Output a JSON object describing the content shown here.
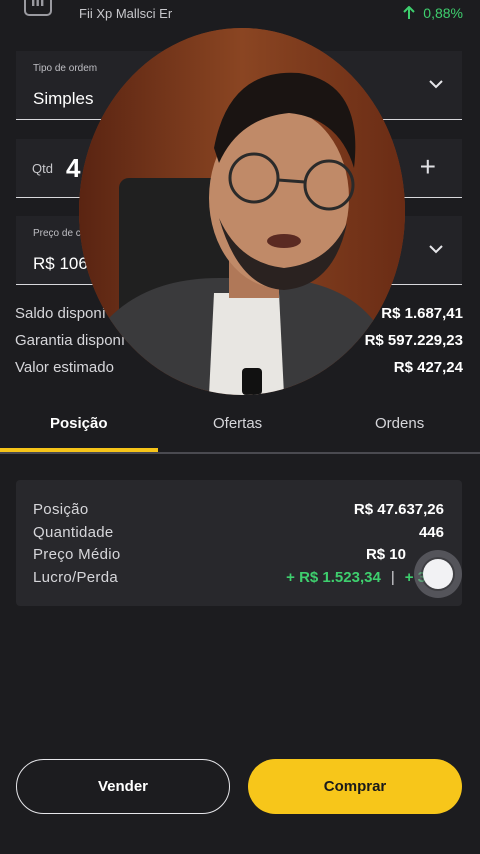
{
  "header": {
    "asset_name": "Fii Xp Mallsci Er",
    "change": "0,88%",
    "icons": {
      "asset": "chart-bars-icon",
      "trend": "arrow-up-icon"
    }
  },
  "order_form": {
    "order_type": {
      "label": "Tipo de ordem",
      "value": "Simples"
    },
    "quantity": {
      "label": "Qtd",
      "value": "4"
    },
    "price": {
      "label": "Preço de c",
      "value": "R$ 106"
    }
  },
  "summary": [
    {
      "label": "Saldo disponí",
      "value": "R$ 1.687,41"
    },
    {
      "label": "Garantia disponí",
      "value": "R$ 597.229,23"
    },
    {
      "label": "Valor estimado",
      "value": "R$ 427,24"
    }
  ],
  "tabs": [
    {
      "label": "Posição",
      "active": true
    },
    {
      "label": "Ofertas",
      "active": false
    },
    {
      "label": "Ordens",
      "active": false
    }
  ],
  "position": {
    "posicao": {
      "label": "Posição",
      "value": "R$ 47.637,26"
    },
    "quantidade": {
      "label": "Quantidade",
      "value": "446"
    },
    "preco_medio": {
      "label": "Preço Médio",
      "value": "R$ 10"
    },
    "lucro": {
      "label": "Lucro/Perda",
      "value": "+ R$ 1.523,34",
      "separator": "|",
      "value2": "+ 3"
    }
  },
  "actions": {
    "sell": "Vender",
    "buy": "Comprar"
  },
  "colors": {
    "accent": "#f7c61a",
    "positive": "#3ecf6e",
    "background": "#1c1c1f"
  }
}
